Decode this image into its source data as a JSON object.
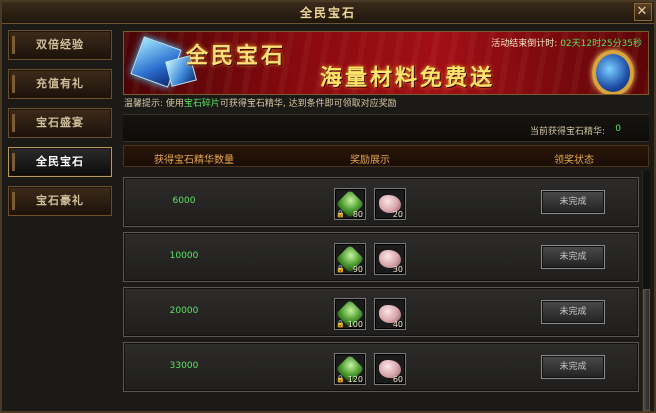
{
  "window": {
    "title": "全民宝石"
  },
  "sidebar": {
    "items": [
      {
        "label": "双倍经验",
        "active": false
      },
      {
        "label": "充值有礼",
        "active": false
      },
      {
        "label": "宝石盛宴",
        "active": false
      },
      {
        "label": "全民宝石",
        "active": true
      },
      {
        "label": "宝石豪礼",
        "active": false
      }
    ]
  },
  "banner": {
    "title": "全民宝石",
    "subtitle": "海量材料免费送",
    "countdown_prefix": "活动结束倒计时: ",
    "countdown": "02天12时25分35秒"
  },
  "tip": {
    "prefix": "温馨提示: 使用",
    "highlight": "宝石碎片",
    "suffix": "可获得宝石精华, 达到条件即可领取对应奖励"
  },
  "current": {
    "label": "当前获得宝石精华:",
    "value": "0"
  },
  "table": {
    "headers": [
      "获得宝石精华数量",
      "奖励展示",
      "领奖状态"
    ],
    "rows": [
      {
        "required": "6000",
        "rewards": [
          {
            "icon": "jade-icon",
            "qty": "80"
          },
          {
            "icon": "stone-icon",
            "qty": "20"
          }
        ],
        "status": "未完成"
      },
      {
        "required": "10000",
        "rewards": [
          {
            "icon": "jade-icon",
            "qty": "90"
          },
          {
            "icon": "stone-icon",
            "qty": "30"
          }
        ],
        "status": "未完成"
      },
      {
        "required": "20000",
        "rewards": [
          {
            "icon": "jade-icon",
            "qty": "100"
          },
          {
            "icon": "stone-icon",
            "qty": "40"
          }
        ],
        "status": "未完成"
      },
      {
        "required": "33000",
        "rewards": [
          {
            "icon": "jade-icon",
            "qty": "120"
          },
          {
            "icon": "stone-icon",
            "qty": "60"
          }
        ],
        "status": "未完成"
      }
    ]
  },
  "icons": {
    "lock": "🔒",
    "close": "✕"
  }
}
